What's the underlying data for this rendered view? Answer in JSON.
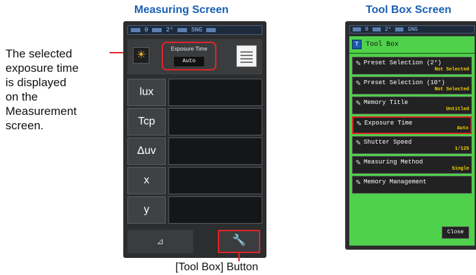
{
  "titles": {
    "measuring": "Measuring Screen",
    "toolbox": "Tool Box Screen"
  },
  "annotations": {
    "selected_exposure": [
      "The selected",
      "exposure time",
      "is displayed",
      "on the",
      "Measurement",
      "screen."
    ],
    "toolbox_button": "[Tool Box] Button"
  },
  "measuring_screen": {
    "status_text": [
      "0",
      "2°",
      "SNG"
    ],
    "exposure_label": "Exposure Time",
    "exposure_value": "Auto",
    "rows": [
      "lux",
      "Tcp",
      "Δuv",
      "x",
      "y"
    ],
    "bottom_left": "⊿",
    "tool_icon": "wrench-icon"
  },
  "toolbox_screen": {
    "status_text": [
      "0",
      "2°",
      "SNG"
    ],
    "header": "Tool Box",
    "items": [
      {
        "name": "Preset Selection (2°)",
        "status": "Not Selected"
      },
      {
        "name": "Preset Selection (10°)",
        "status": "Not Selected"
      },
      {
        "name": "Memory Title",
        "status": "Untitled"
      },
      {
        "name": "Exposure Time",
        "status": "Auto"
      },
      {
        "name": "Shutter Speed",
        "status": "1/125"
      },
      {
        "name": "Measuring Method",
        "status": "Single"
      },
      {
        "name": "Memory Management",
        "status": ""
      }
    ],
    "close": "Close"
  },
  "colors": {
    "title_blue": "#1a5fb4",
    "highlight_red": "#e0252b",
    "toolbox_green": "#4fd14b",
    "status_yellow": "#f5d200"
  }
}
